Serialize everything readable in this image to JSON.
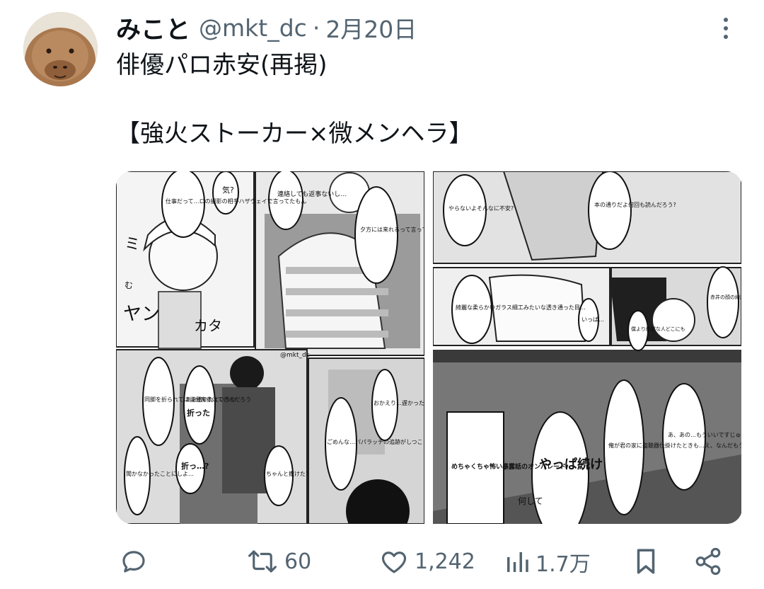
{
  "tweet": {
    "display_name": "みこと",
    "handle": "@mkt_dc",
    "separator": "·",
    "date": "2月20日",
    "text_line1": "俳優パロ赤安(再掲)",
    "text_line2": "【強火ストーカー×微メンヘラ】"
  },
  "media": {
    "image1": {
      "watermark": "@mkt_dc",
      "bubbles": [
        "気?",
        "連絡しても返事ないし…",
        "夕方には来れるって言ってたのにもう夜だし……",
        "仕事だって…ロの撮影の相手ハザウェイで言ってたもん",
        "ミ",
        "む",
        "ヤン",
        "カタ",
        "ああ撒いたというか",
        "折った",
        "同脚を折られては当分魔赤はできんだろう",
        "折っ…?",
        "聞かなかったことにしよ…",
        "おかえり…遅かったですね",
        "ごめんな…パパラッチの追跡がしつこくて",
        "ちゃんと撒けた?"
      ]
    },
    "image2": {
      "bubbles": [
        "本の通りだよ何回も読んだろう?",
        "やらないよそんなに不安?",
        "赤井の顔の綺麗な人いっぱいいるから",
        "綺麗な柔らかいガラス細工みたいな透き通った目…",
        "いっぱ…",
        "僕より綺麗な人どこにも",
        "あ、あの…もういいですじゅうぶんです…",
        "俺が君の家に盗聴器仕掛けたときも…え、なんだもういい?",
        "めちゃくちゃ怖い暴露話のオンパレード",
        "やっぱ続け",
        "何して"
      ]
    }
  },
  "actions": {
    "reply_count": "",
    "retweet_count": "60",
    "like_count": "1,242",
    "view_count": "1.7万"
  },
  "colors": {
    "text": "#0f1419",
    "secondary": "#536471",
    "background": "#ffffff"
  },
  "icons": [
    "avatar-capybara",
    "more-icon",
    "reply-icon",
    "retweet-icon",
    "like-icon",
    "views-icon",
    "bookmark-icon",
    "share-icon"
  ]
}
